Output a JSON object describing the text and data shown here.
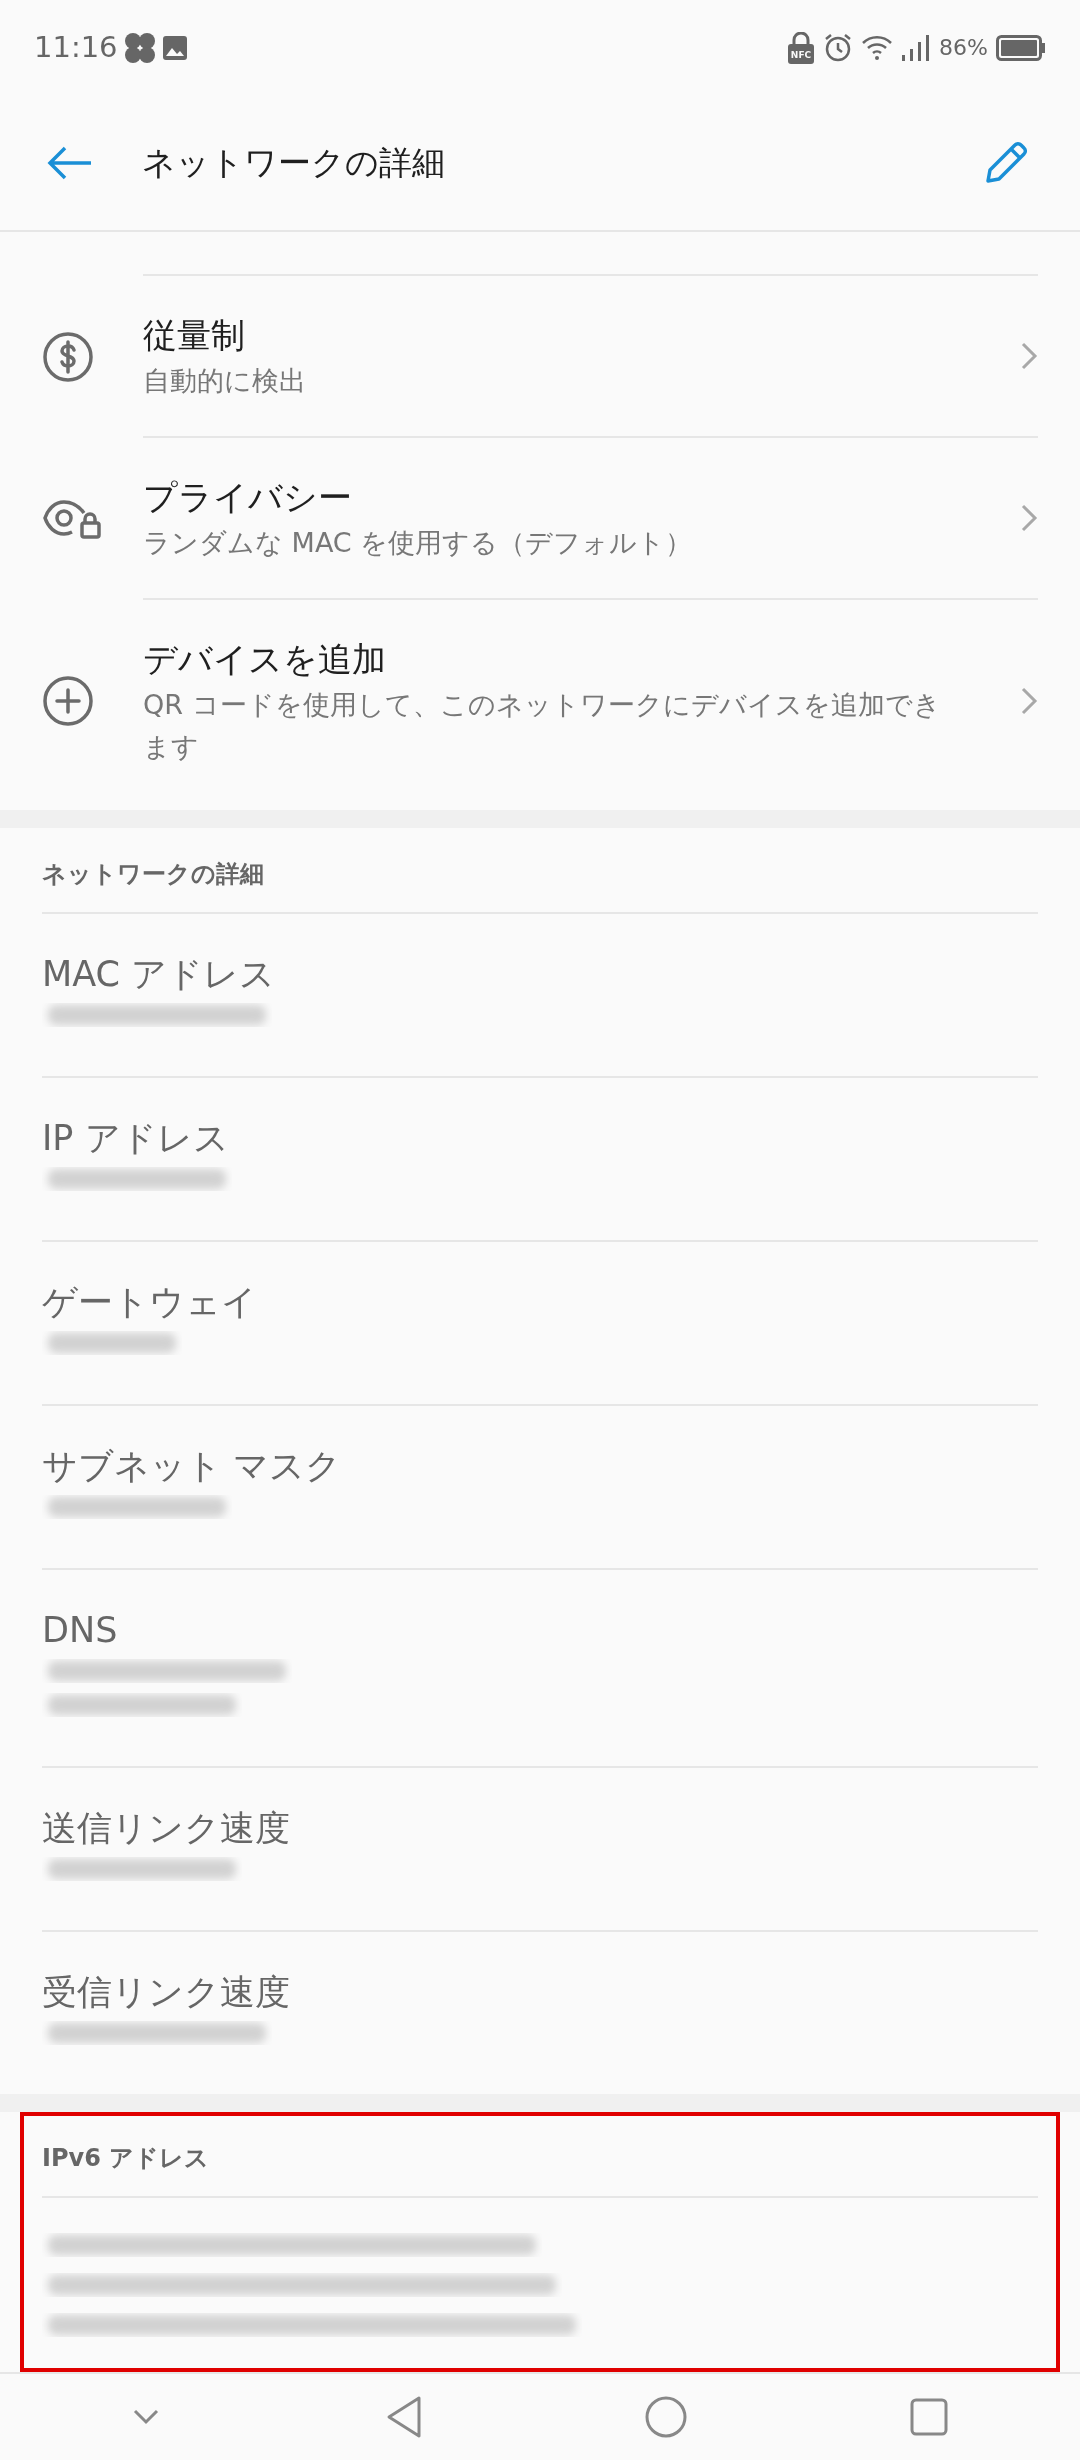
{
  "status_bar": {
    "time": "11:16",
    "nfc_label": "NFC",
    "battery": "86%"
  },
  "app_bar": {
    "title": "ネットワークの詳細"
  },
  "settings": [
    {
      "kind": "metered",
      "title": "従量制",
      "subtitle": "自動的に検出"
    },
    {
      "kind": "privacy",
      "title": "プライバシー",
      "subtitle": "ランダムな MAC を使用する（デフォルト）"
    },
    {
      "kind": "add",
      "title": "デバイスを追加",
      "subtitle": "QR コードを使用して、このネットワークにデバイスを追加できます"
    }
  ],
  "details": {
    "header": "ネットワークの詳細",
    "rows": [
      {
        "label": "MAC アドレス",
        "values": [
          {
            "kind": "blurred"
          }
        ]
      },
      {
        "label": "IP アドレス",
        "values": [
          {
            "kind": "blurred"
          }
        ]
      },
      {
        "label": "ゲートウェイ",
        "values": [
          {
            "kind": "blurred"
          }
        ]
      },
      {
        "label": "サブネット マスク",
        "values": [
          {
            "kind": "blurred"
          }
        ]
      },
      {
        "label": "DNS",
        "values": [
          {
            "kind": "blurred"
          },
          {
            "kind": "blurred"
          }
        ]
      },
      {
        "label": "送信リンク速度",
        "values": [
          {
            "kind": "blurred"
          }
        ]
      },
      {
        "label": "受信リンク速度",
        "values": [
          {
            "kind": "blurred"
          }
        ]
      }
    ]
  },
  "ipv6": {
    "header": "IPv6 アドレス",
    "highlighted": true,
    "values": [
      {
        "kind": "blurred"
      },
      {
        "kind": "blurred"
      },
      {
        "kind": "blurred"
      }
    ]
  }
}
